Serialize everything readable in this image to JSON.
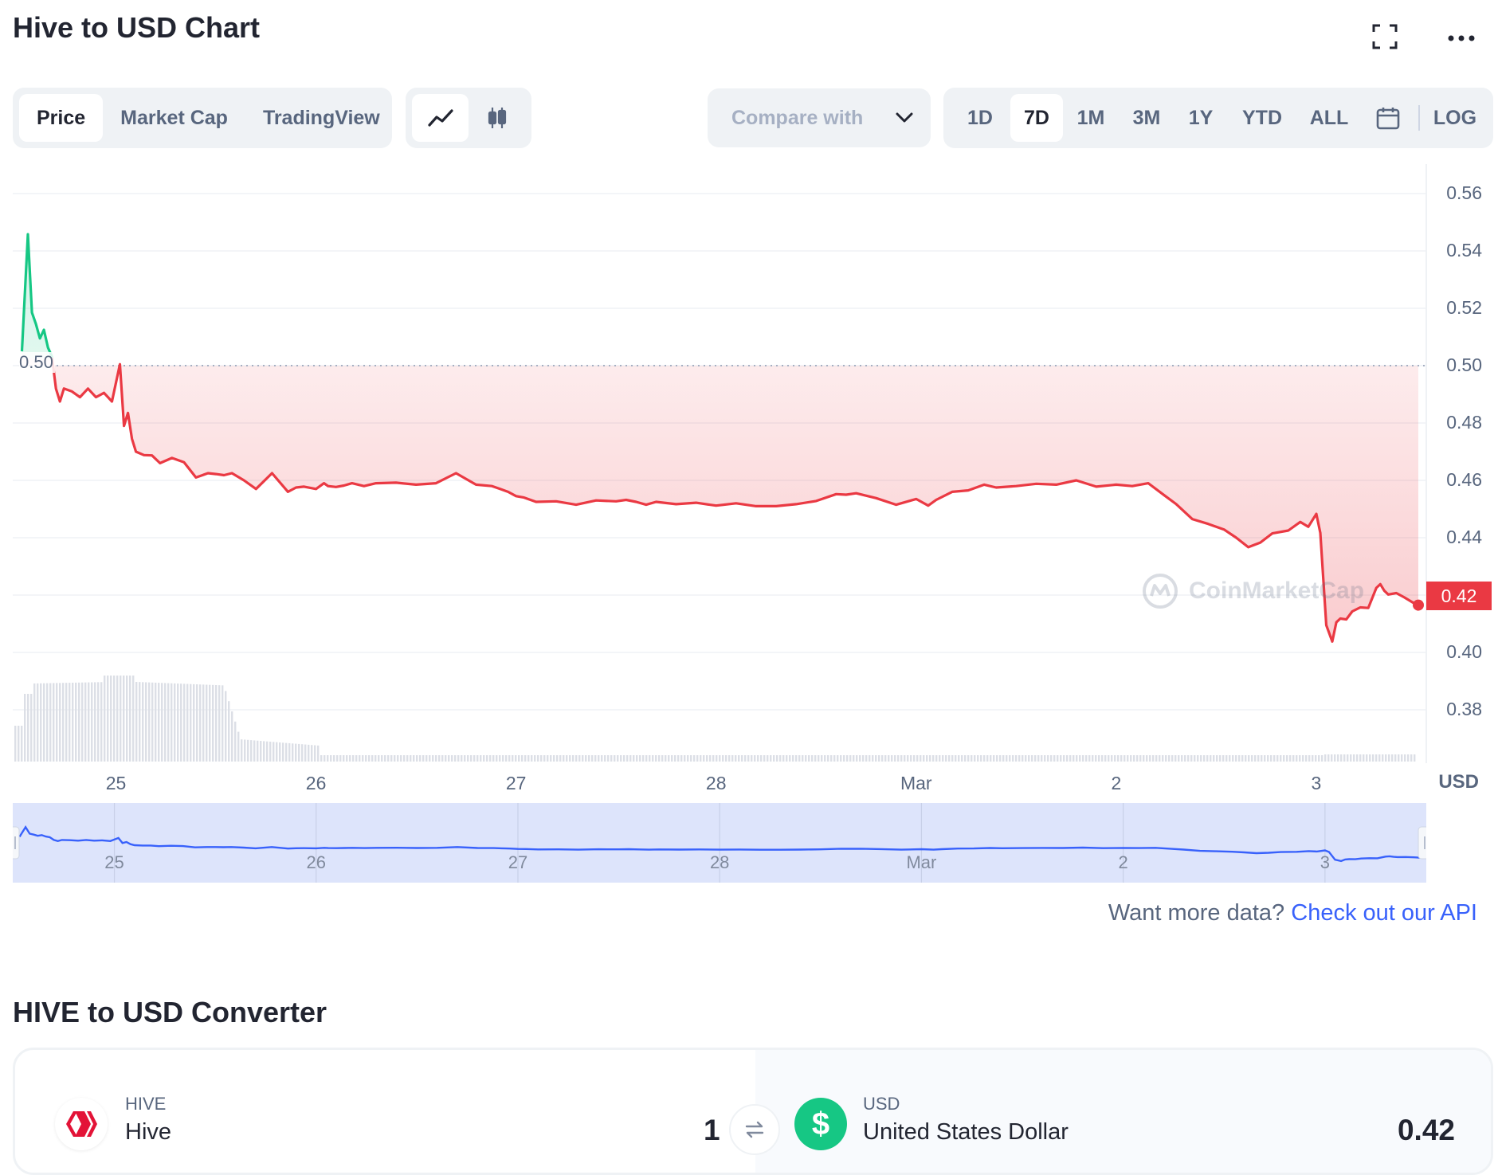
{
  "header": {
    "title": "Hive to USD Chart"
  },
  "tabs": [
    {
      "label": "Price",
      "active": true
    },
    {
      "label": "Market Cap",
      "active": false
    },
    {
      "label": "TradingView",
      "active": false
    }
  ],
  "chart_style": {
    "selected": "line-chart-icon",
    "other": "candlestick-icon"
  },
  "compare": {
    "placeholder": "Compare with"
  },
  "timeframes": [
    {
      "label": "1D",
      "active": false
    },
    {
      "label": "7D",
      "active": true
    },
    {
      "label": "1M",
      "active": false
    },
    {
      "label": "3M",
      "active": false
    },
    {
      "label": "1Y",
      "active": false
    },
    {
      "label": "YTD",
      "active": false
    },
    {
      "label": "ALL",
      "active": false
    }
  ],
  "log_label": "LOG",
  "colors": {
    "up": "#16c784",
    "down": "#ea3943",
    "accent": "#3861fb",
    "navigator_fill": "#dde4fb"
  },
  "chart_data": {
    "type": "line",
    "currency_label": "USD",
    "watermark": "CoinMarketCap",
    "reference_price": 0.5,
    "reference_label": "0.50",
    "current_price_label": "0.42",
    "y_ticks": [
      "0.56",
      "0.54",
      "0.52",
      "0.50",
      "0.48",
      "0.46",
      "0.44",
      "0.42",
      "0.40",
      "0.38"
    ],
    "ylim": [
      0.3625,
      0.5625
    ],
    "x_ticks": [
      "25",
      "26",
      "27",
      "28",
      "Mar",
      "2",
      "3"
    ],
    "x_tick_values": [
      25,
      26,
      27,
      28,
      29,
      30,
      31
    ],
    "xlim": [
      24.52,
      31.51
    ],
    "series": [
      {
        "x": [
          24.53,
          24.56,
          24.58,
          24.6,
          24.62,
          24.64,
          24.66,
          24.68,
          24.7,
          24.72,
          24.74,
          24.78,
          24.82,
          24.86,
          24.9,
          24.94,
          24.98,
          25.02,
          25.04,
          25.06,
          25.08,
          25.1,
          25.14,
          25.18,
          25.22,
          25.28,
          25.34,
          25.4,
          25.46,
          25.5,
          25.54,
          25.58,
          25.64,
          25.7,
          25.78,
          25.86,
          25.9,
          25.94,
          26.0,
          26.04,
          26.06,
          26.1,
          26.14,
          26.18,
          26.24,
          26.3,
          26.4,
          26.5,
          26.6,
          26.7,
          26.8,
          26.88,
          26.92,
          26.96,
          27.0,
          27.04,
          27.1,
          27.2,
          27.3,
          27.4,
          27.5,
          27.55,
          27.6,
          27.65,
          27.7,
          27.8,
          27.9,
          28.0,
          28.1,
          28.2,
          28.3,
          28.4,
          28.5,
          28.6,
          28.65,
          28.7,
          28.8,
          28.9,
          29.0,
          29.06,
          29.1,
          29.18,
          29.26,
          29.34,
          29.4,
          29.5,
          29.6,
          29.7,
          29.8,
          29.9,
          30.0,
          30.08,
          30.16,
          30.24,
          30.3,
          30.38,
          30.46,
          30.54,
          30.6,
          30.66,
          30.72,
          30.78,
          30.86,
          30.92,
          30.96,
          31.0,
          31.02,
          31.05,
          31.08,
          31.1,
          31.12,
          31.15,
          31.18,
          31.22,
          31.26,
          31.3,
          31.32,
          31.34,
          31.36,
          31.4,
          31.44,
          31.48,
          31.51
        ],
        "y": [
          0.505,
          0.5458,
          0.5185,
          0.5145,
          0.5095,
          0.5125,
          0.5063,
          0.5032,
          0.492,
          0.4875,
          0.492,
          0.491,
          0.489,
          0.492,
          0.489,
          0.4905,
          0.4875,
          0.5005,
          0.479,
          0.4835,
          0.4745,
          0.47,
          0.4688,
          0.4687,
          0.466,
          0.4678,
          0.4663,
          0.461,
          0.4625,
          0.4622,
          0.4618,
          0.4625,
          0.46,
          0.457,
          0.4625,
          0.456,
          0.4575,
          0.4578,
          0.457,
          0.459,
          0.458,
          0.4577,
          0.4582,
          0.459,
          0.458,
          0.459,
          0.4592,
          0.4585,
          0.459,
          0.4625,
          0.4585,
          0.458,
          0.457,
          0.456,
          0.4545,
          0.454,
          0.4525,
          0.4527,
          0.4515,
          0.453,
          0.4527,
          0.4532,
          0.4525,
          0.4515,
          0.4525,
          0.4517,
          0.4522,
          0.4512,
          0.452,
          0.451,
          0.451,
          0.4517,
          0.4528,
          0.4552,
          0.455,
          0.4555,
          0.4538,
          0.4515,
          0.4535,
          0.4512,
          0.4532,
          0.456,
          0.4565,
          0.4585,
          0.4575,
          0.458,
          0.4588,
          0.4585,
          0.46,
          0.4578,
          0.4585,
          0.458,
          0.459,
          0.4548,
          0.4517,
          0.4465,
          0.4448,
          0.4428,
          0.44,
          0.4367,
          0.4383,
          0.4415,
          0.4425,
          0.4455,
          0.4438,
          0.4483,
          0.4417,
          0.4095,
          0.4038,
          0.4105,
          0.4118,
          0.4115,
          0.4143,
          0.4157,
          0.4155,
          0.4225,
          0.4238,
          0.4215,
          0.4202,
          0.4207,
          0.4192,
          0.4175,
          0.4165
        ]
      }
    ]
  },
  "navigator_ticks": [
    "25",
    "26",
    "27",
    "28",
    "Mar",
    "2",
    "3"
  ],
  "api": {
    "prompt": "Want more data?",
    "link": "Check out our API"
  },
  "converter": {
    "title": "HIVE to USD Converter",
    "from": {
      "symbol": "HIVE",
      "name": "Hive",
      "amount": "1"
    },
    "to": {
      "symbol": "USD",
      "name": "United States Dollar",
      "amount": "0.42",
      "icon_glyph": "$"
    }
  }
}
